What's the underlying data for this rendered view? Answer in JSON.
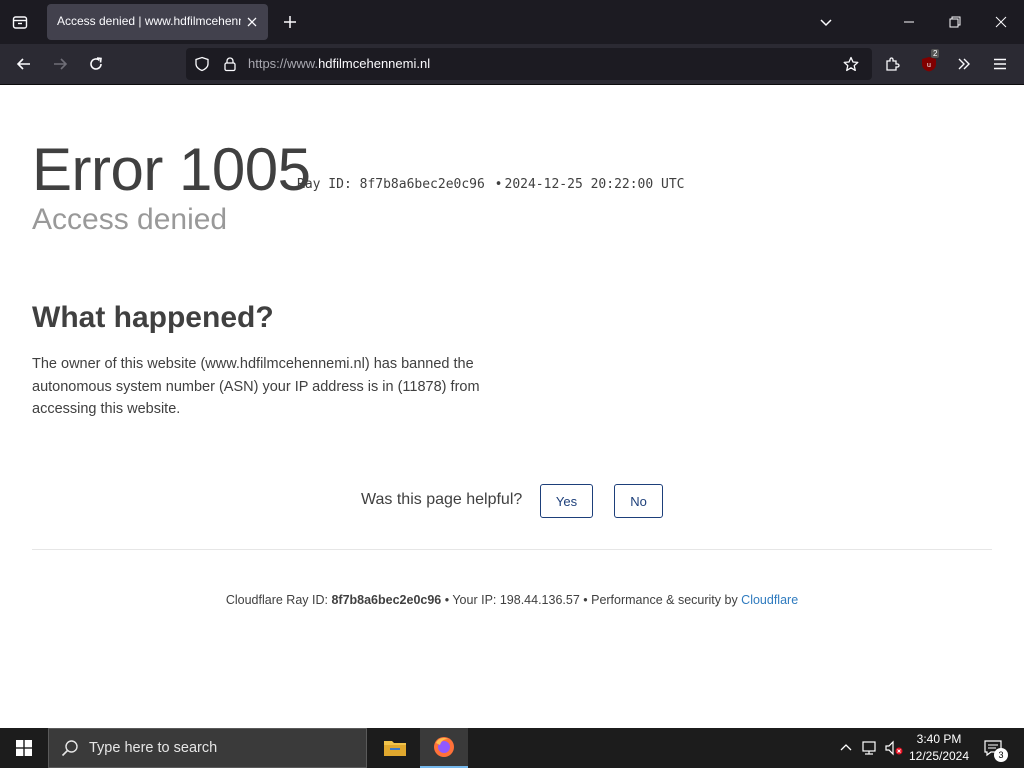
{
  "browser": {
    "tab_title": "Access denied | www.hdfilmcehennemi.nl",
    "url_prefix": "https://www.",
    "url_domain": "hdfilmcehennemi.nl",
    "extension_badge": "2"
  },
  "page": {
    "error_title": "Error 1005",
    "ray_label": "Ray ID: 8f7b8a6bec2e0c96",
    "ray_separator": "•",
    "timestamp": "2024-12-25 20:22:00 UTC",
    "subtitle": "Access denied",
    "section_title": "What happened?",
    "section_text": "The owner of this website (www.hdfilmcehennemi.nl) has banned the autonomous system number (ASN) your IP address is in (11878) from accessing this website.",
    "feedback_question": "Was this page helpful?",
    "yes_label": "Yes",
    "no_label": "No",
    "footer": {
      "ray_prefix": "Cloudflare Ray ID: ",
      "ray_id": "8f7b8a6bec2e0c96",
      "ip_text": " • Your IP: 198.44.136.57 • Performance & security by ",
      "cloudflare_link": "Cloudflare"
    }
  },
  "taskbar": {
    "search_placeholder": "Type here to search",
    "time": "3:40 PM",
    "date": "12/25/2024",
    "notification_count": "3"
  },
  "colors": {
    "link": "#2f7bbf",
    "button_border": "#1d3f7a",
    "text": "#404040",
    "muted": "#999999"
  }
}
